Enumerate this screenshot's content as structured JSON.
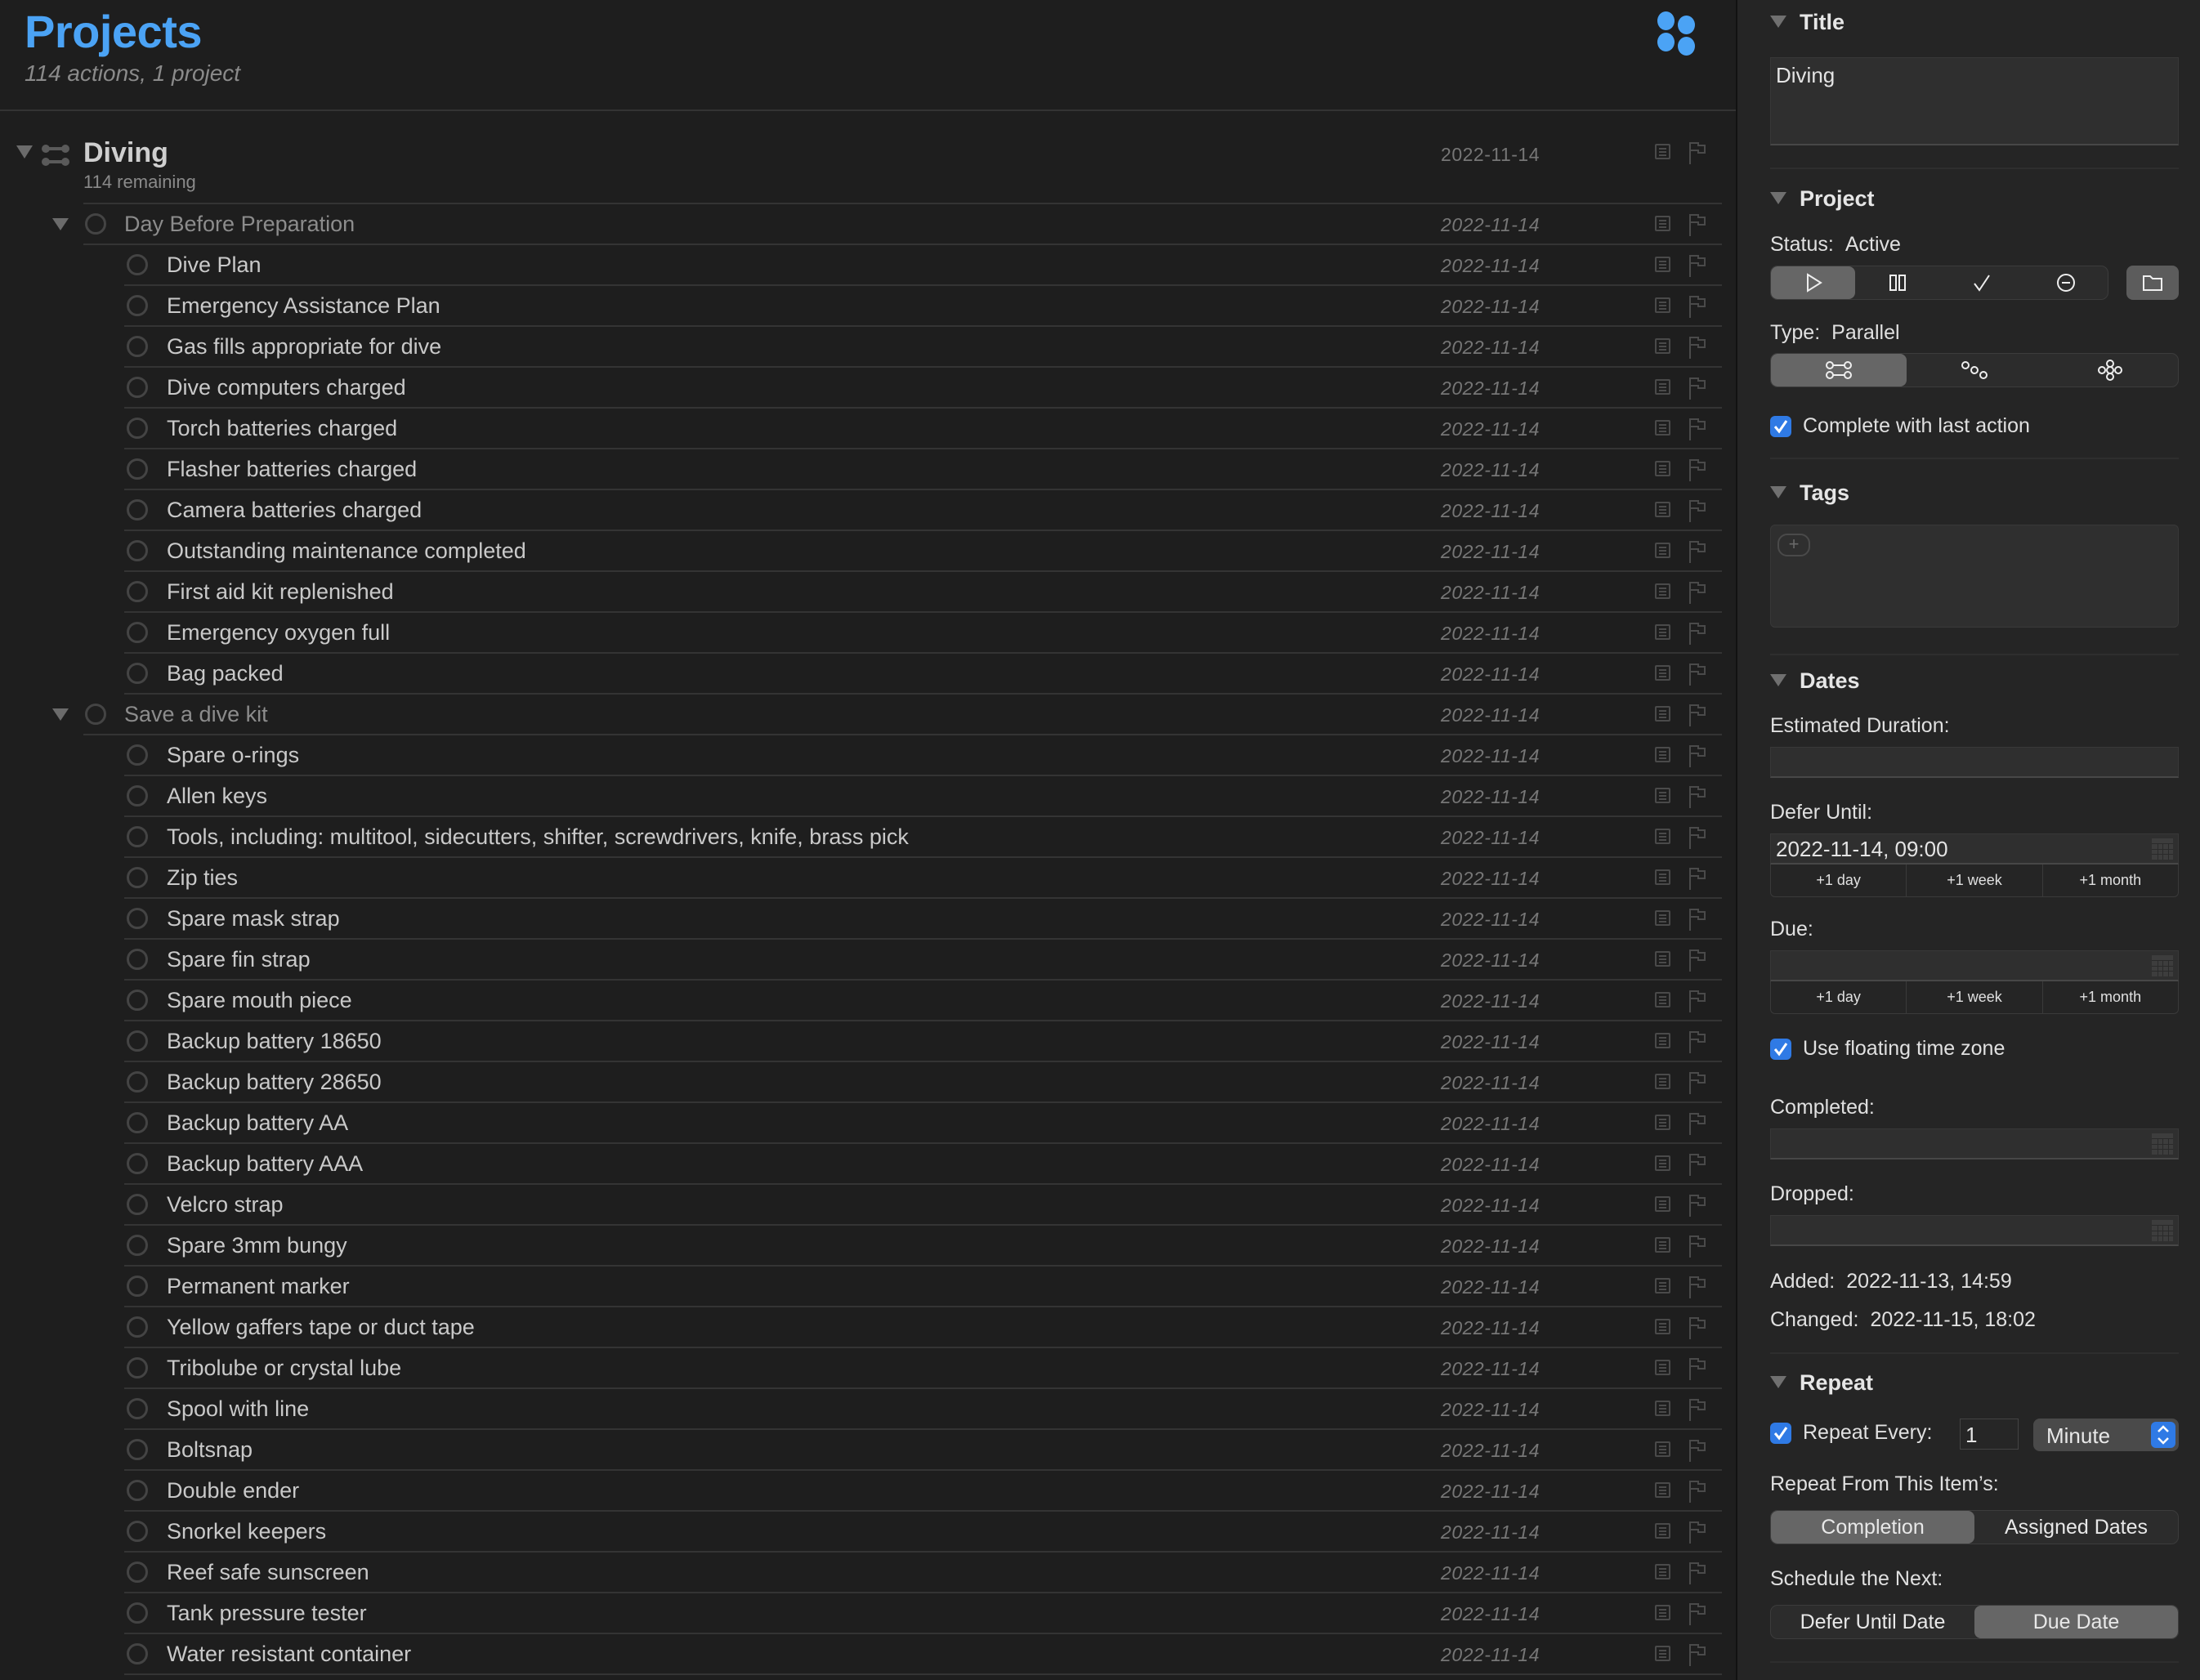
{
  "header": {
    "title": "Projects",
    "subtitle": "114 actions, 1 project",
    "perspective_icon": "projects-perspective-icon",
    "accent_color": "#4ba3f5"
  },
  "project": {
    "title": "Diving",
    "remaining": "114 remaining",
    "date": "2022-11-14",
    "icon": "parallel-project-icon"
  },
  "rows": [
    {
      "kind": "group",
      "label": "Day Before Preparation",
      "date": "2022-11-14"
    },
    {
      "kind": "task",
      "label": "Dive Plan",
      "date": "2022-11-14"
    },
    {
      "kind": "task",
      "label": "Emergency Assistance Plan",
      "date": "2022-11-14"
    },
    {
      "kind": "task",
      "label": "Gas fills appropriate for dive",
      "date": "2022-11-14"
    },
    {
      "kind": "task",
      "label": "Dive computers charged",
      "date": "2022-11-14"
    },
    {
      "kind": "task",
      "label": "Torch batteries charged",
      "date": "2022-11-14"
    },
    {
      "kind": "task",
      "label": "Flasher batteries charged",
      "date": "2022-11-14"
    },
    {
      "kind": "task",
      "label": "Camera batteries charged",
      "date": "2022-11-14"
    },
    {
      "kind": "task",
      "label": "Outstanding maintenance completed",
      "date": "2022-11-14"
    },
    {
      "kind": "task",
      "label": "First aid kit replenished",
      "date": "2022-11-14"
    },
    {
      "kind": "task",
      "label": "Emergency oxygen full",
      "date": "2022-11-14"
    },
    {
      "kind": "task",
      "label": "Bag packed",
      "date": "2022-11-14"
    },
    {
      "kind": "group",
      "label": "Save a dive kit",
      "date": "2022-11-14"
    },
    {
      "kind": "task",
      "label": "Spare o-rings",
      "date": "2022-11-14"
    },
    {
      "kind": "task",
      "label": "Allen keys",
      "date": "2022-11-14"
    },
    {
      "kind": "task",
      "label": "Tools, including: multitool, sidecutters, shifter, screwdrivers, knife, brass pick",
      "date": "2022-11-14"
    },
    {
      "kind": "task",
      "label": "Zip ties",
      "date": "2022-11-14"
    },
    {
      "kind": "task",
      "label": "Spare mask strap",
      "date": "2022-11-14"
    },
    {
      "kind": "task",
      "label": "Spare fin strap",
      "date": "2022-11-14"
    },
    {
      "kind": "task",
      "label": "Spare mouth piece",
      "date": "2022-11-14"
    },
    {
      "kind": "task",
      "label": "Backup battery 18650",
      "date": "2022-11-14"
    },
    {
      "kind": "task",
      "label": "Backup battery 28650",
      "date": "2022-11-14"
    },
    {
      "kind": "task",
      "label": "Backup battery AA",
      "date": "2022-11-14"
    },
    {
      "kind": "task",
      "label": "Backup battery AAA",
      "date": "2022-11-14"
    },
    {
      "kind": "task",
      "label": "Velcro strap",
      "date": "2022-11-14"
    },
    {
      "kind": "task",
      "label": "Spare 3mm bungy",
      "date": "2022-11-14"
    },
    {
      "kind": "task",
      "label": "Permanent marker",
      "date": "2022-11-14"
    },
    {
      "kind": "task",
      "label": "Yellow gaffers tape or duct tape",
      "date": "2022-11-14"
    },
    {
      "kind": "task",
      "label": "Tribolube or crystal lube",
      "date": "2022-11-14"
    },
    {
      "kind": "task",
      "label": "Spool with line",
      "date": "2022-11-14"
    },
    {
      "kind": "task",
      "label": "Boltsnap",
      "date": "2022-11-14"
    },
    {
      "kind": "task",
      "label": "Double ender",
      "date": "2022-11-14"
    },
    {
      "kind": "task",
      "label": "Snorkel keepers",
      "date": "2022-11-14"
    },
    {
      "kind": "task",
      "label": "Reef safe sunscreen",
      "date": "2022-11-14"
    },
    {
      "kind": "task",
      "label": "Tank pressure tester",
      "date": "2022-11-14"
    },
    {
      "kind": "task",
      "label": "Water resistant container",
      "date": "2022-11-14"
    }
  ],
  "inspector": {
    "title_section": {
      "heading": "Title",
      "value": "Diving"
    },
    "project_section": {
      "heading": "Project",
      "status_label": "Status:",
      "status_value": "Active",
      "status_options": [
        "active",
        "on-hold",
        "completed",
        "dropped"
      ],
      "status_selected": "active",
      "type_label": "Type:",
      "type_value": "Parallel",
      "type_options": [
        "parallel",
        "sequential",
        "single-actions"
      ],
      "type_selected": "parallel",
      "complete_with_last_label": "Complete with last action",
      "complete_with_last_checked": true
    },
    "tags_section": {
      "heading": "Tags",
      "tags": []
    },
    "dates_section": {
      "heading": "Dates",
      "estimated_duration_label": "Estimated Duration:",
      "estimated_duration_value": "",
      "defer_label": "Defer Until:",
      "defer_value": "2022-11-14, 09:00",
      "due_label": "Due:",
      "due_value": "",
      "steps": [
        "+1 day",
        "+1 week",
        "+1 month"
      ],
      "floating_tz_label": "Use floating time zone",
      "floating_tz_checked": true,
      "completed_label": "Completed:",
      "completed_value": "",
      "dropped_label": "Dropped:",
      "dropped_value": "",
      "added_label": "Added:",
      "added_value": "2022-11-13, 14:59",
      "changed_label": "Changed:",
      "changed_value": "2022-11-15, 18:02"
    },
    "repeat_section": {
      "heading": "Repeat",
      "repeat_every_label": "Repeat Every:",
      "repeat_every_checked": true,
      "repeat_every_value": "1",
      "repeat_unit": "Minute",
      "repeat_from_label": "Repeat From This Item’s:",
      "repeat_from_options": [
        "Completion",
        "Assigned Dates"
      ],
      "repeat_from_selected": "Completion",
      "schedule_label": "Schedule the Next:",
      "schedule_options": [
        "Defer Until Date",
        "Due Date"
      ],
      "schedule_selected": "Due Date"
    },
    "checkbox_color": "#2f7ae5"
  }
}
